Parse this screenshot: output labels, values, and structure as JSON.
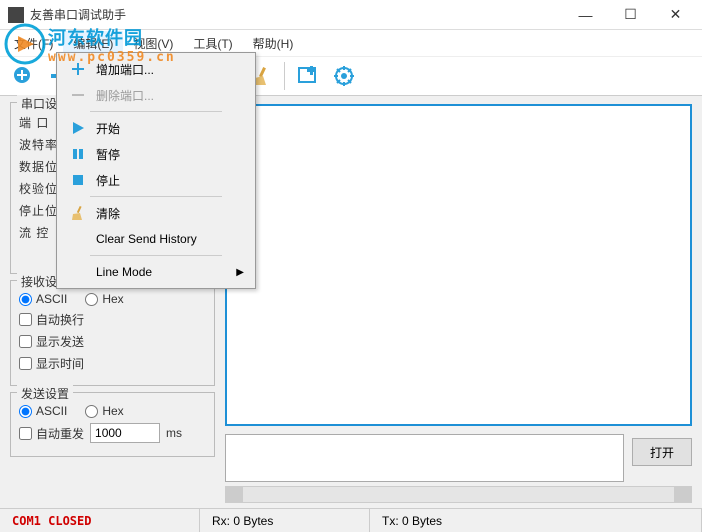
{
  "window": {
    "title": "友善串口调试助手"
  },
  "win_buttons": {
    "min": "—",
    "max": "☐",
    "close": "✕"
  },
  "menubar": [
    "文件(F)",
    "编辑(E)",
    "视图(V)",
    "工具(T)",
    "帮助(H)"
  ],
  "dropdown": {
    "add_port": "增加端口...",
    "del_port": "删除端口...",
    "start": "开始",
    "pause": "暂停",
    "stop": "停止",
    "clear": "清除",
    "clear_send": "Clear Send History",
    "line_mode": "Line Mode"
  },
  "sidebar": {
    "serial_group": "串口设置",
    "port_label": "端  口",
    "baud_label": "波特率",
    "data_label": "数据位",
    "parity_label": "校验位",
    "stop_label": "停止位",
    "flow_label": "流  控",
    "recv_group": "接收设置",
    "ascii_label": "ASCII",
    "hex_label": "Hex",
    "wrap_label": "自动换行",
    "show_send_label": "显示发送",
    "show_time_label": "显示时间",
    "send_group": "发送设置",
    "auto_resend_label": "自动重发",
    "interval_value": "1000",
    "interval_unit": "ms"
  },
  "buttons": {
    "open": "打开"
  },
  "status": {
    "port": "COM1 CLOSED",
    "rx": "Rx: 0 Bytes",
    "tx": "Tx: 0 Bytes"
  },
  "watermark": {
    "name": "河东软件园",
    "url": "www.pc0359.cn"
  }
}
